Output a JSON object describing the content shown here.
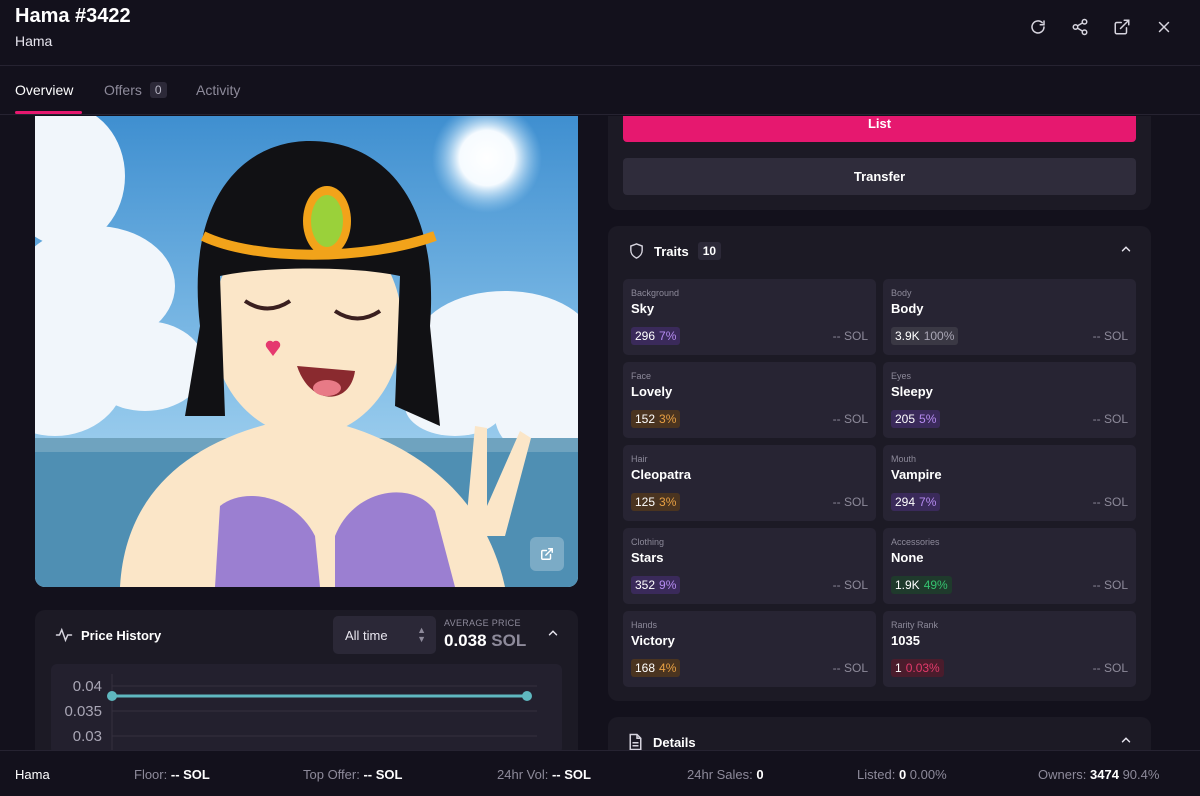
{
  "header": {
    "title": "Hama #3422",
    "subtitle": "Hama",
    "icons": [
      "refresh-icon",
      "share-icon",
      "external-link-icon",
      "close-icon"
    ]
  },
  "tabs": [
    {
      "label": "Overview",
      "active": true
    },
    {
      "label": "Offers",
      "count": "0"
    },
    {
      "label": "Activity"
    }
  ],
  "actions": {
    "list_label": "List",
    "transfer_label": "Transfer"
  },
  "price_history": {
    "title": "Price History",
    "range": "All time",
    "avg_label": "AVERAGE PRICE",
    "avg_value": "0.038",
    "avg_unit": "SOL"
  },
  "chart_data": {
    "type": "line",
    "yticks": [
      "0.04",
      "0.035",
      "0.03"
    ],
    "series": [
      {
        "values": [
          0.038,
          0.038
        ]
      }
    ]
  },
  "traits": {
    "title": "Traits",
    "count": "10",
    "items": [
      {
        "type": "Background",
        "value": "Sky",
        "count": "296",
        "pct": "7%",
        "price": "-- SOL",
        "tone": "purple"
      },
      {
        "type": "Body",
        "value": "Body",
        "count": "3.9K",
        "pct": "100%",
        "price": "-- SOL",
        "tone": "gray"
      },
      {
        "type": "Face",
        "value": "Lovely",
        "count": "152",
        "pct": "3%",
        "price": "-- SOL",
        "tone": "orange"
      },
      {
        "type": "Eyes",
        "value": "Sleepy",
        "count": "205",
        "pct": "5%",
        "price": "-- SOL",
        "tone": "purple"
      },
      {
        "type": "Hair",
        "value": "Cleopatra",
        "count": "125",
        "pct": "3%",
        "price": "-- SOL",
        "tone": "orange"
      },
      {
        "type": "Mouth",
        "value": "Vampire",
        "count": "294",
        "pct": "7%",
        "price": "-- SOL",
        "tone": "purple"
      },
      {
        "type": "Clothing",
        "value": "Stars",
        "count": "352",
        "pct": "9%",
        "price": "-- SOL",
        "tone": "purple"
      },
      {
        "type": "Accessories",
        "value": "None",
        "count": "1.9K",
        "pct": "49%",
        "price": "-- SOL",
        "tone": "green"
      },
      {
        "type": "Hands",
        "value": "Victory",
        "count": "168",
        "pct": "4%",
        "price": "-- SOL",
        "tone": "orange"
      },
      {
        "type": "Rarity Rank",
        "value": "1035",
        "count": "1",
        "pct": "0.03%",
        "price": "-- SOL",
        "tone": "red"
      }
    ]
  },
  "details": {
    "title": "Details"
  },
  "footer": {
    "collection": "Hama",
    "floor_label": "Floor:",
    "floor_value": "-- SOL",
    "top_offer_label": "Top Offer:",
    "top_offer_value": "-- SOL",
    "vol_label": "24hr Vol:",
    "vol_value": "-- SOL",
    "sales_label": "24hr Sales:",
    "sales_value": "0",
    "listed_label": "Listed:",
    "listed_value": "0",
    "listed_pct": "0.00%",
    "owners_label": "Owners:",
    "owners_value": "3474",
    "owners_pct": "90.4%"
  },
  "colors": {
    "accent": "#e6186f",
    "background": "#13111c",
    "card": "#1c1a25",
    "chart_line": "#5fb8c0"
  }
}
